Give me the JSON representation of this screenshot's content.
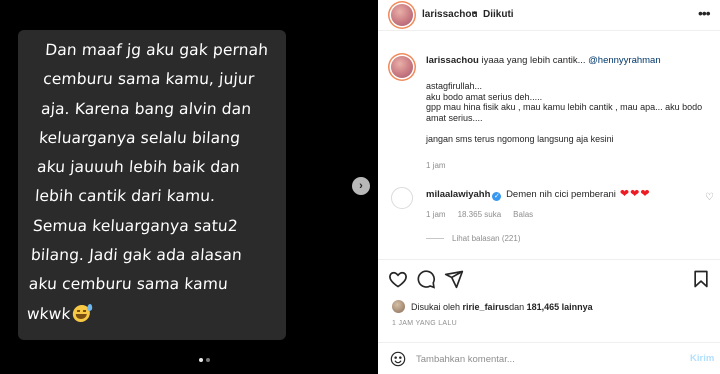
{
  "media": {
    "quote_text": "Dan maaf jg aku gak pernah\ncemburu sama kamu, jujur\naja. Karena bang alvin dan\nkeluarganya selalu bilang\naku jauuuh lebih baik dan\nlebih cantik dari kamu.\nSemua keluarganya satu2\nbilang. Jadi gak ada alasan\naku cemburu sama kamu\nwkwk",
    "carousel_total": 2,
    "carousel_active": 1
  },
  "header": {
    "username": "larissachou",
    "separator": "•",
    "follow_label": "Diikuti",
    "more_icon": "more-horizontal-icon"
  },
  "caption": {
    "username": "larissachou",
    "text": "iyaaa yang lebih cantik... ",
    "mention": "@hennyyrahman",
    "lines": [
      "astagfirullah...",
      "aku bodo amat serius deh.....",
      "gpp mau hina fisik aku , mau kamu lebih cantik , mau apa... aku bodo amat serius....",
      "",
      "jangan sms terus ngomong langsung aja kesini"
    ],
    "time": "1 jam"
  },
  "comment": {
    "username": "milaalawiyahh",
    "text": "Demen nih cici pemberani",
    "hearts": "❤❤❤",
    "time": "1 jam",
    "likes": "18.365 suka",
    "reply_label": "Balas",
    "view_replies": "Lihat balasan (221)"
  },
  "likes": {
    "prefix": "Disukai oleh ",
    "user": "ririe_fairus",
    "middle": " dan ",
    "count": "181,465 lainnya"
  },
  "post_time": "1 JAM YANG LALU",
  "comment_box": {
    "placeholder": "Tambahkan komentar...",
    "post_label": "Kirim"
  },
  "colors": {
    "accent_blue": "#3897f0",
    "post_button_disabled": "#b2dffc",
    "heart_red": "#ed1c24",
    "muted_text": "#8e8e8e"
  }
}
